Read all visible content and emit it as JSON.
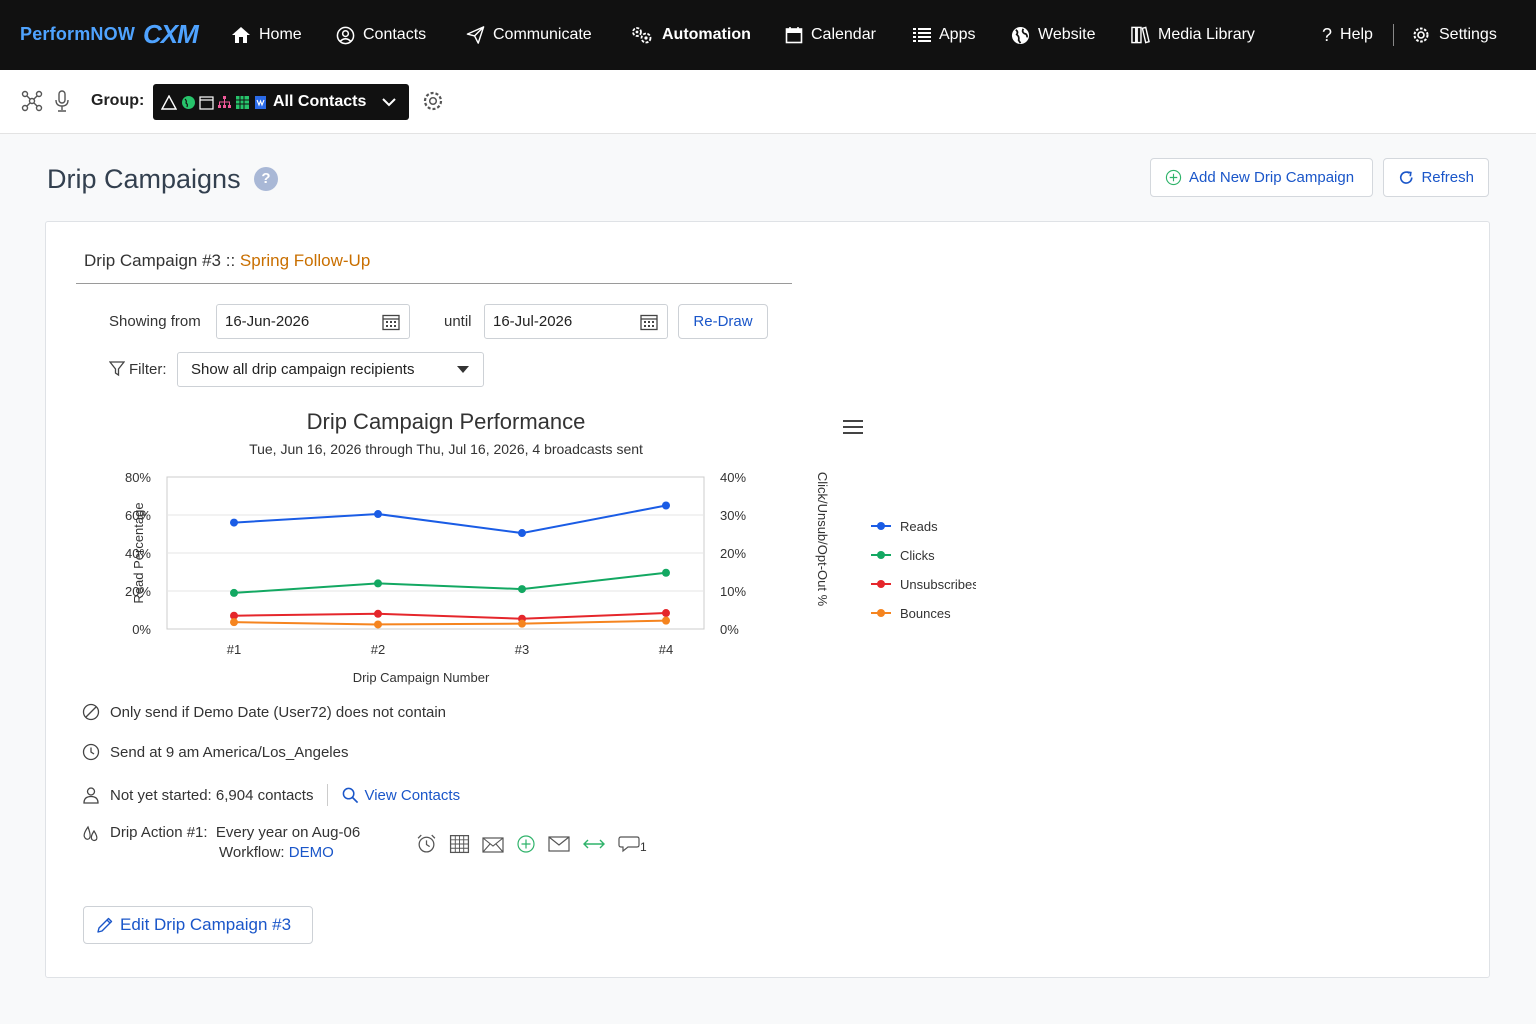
{
  "brand": {
    "name": "PerformNOW",
    "suffix": "CXM",
    "color": "#4fa3ff"
  },
  "nav": {
    "home": "Home",
    "contacts": "Contacts",
    "communicate": "Communicate",
    "automation": "Automation",
    "calendar": "Calendar",
    "apps": "Apps",
    "website": "Website",
    "media": "Media Library",
    "help": "Help",
    "settings": "Settings"
  },
  "group": {
    "label": "Group:",
    "selected": "All Contacts"
  },
  "page": {
    "title": "Drip Campaigns",
    "help": "?",
    "add_button": "Add New Drip Campaign",
    "refresh_button": "Refresh"
  },
  "campaign": {
    "prefix": "Drip Campaign #3 :: ",
    "name": "Spring Follow-Up",
    "showing_from_label": "Showing from",
    "from_date": "16-Jun-2026",
    "until_label": "until",
    "until_date": "16-Jul-2026",
    "redraw": "Re-Draw",
    "filter_label": "Filter:",
    "filter_value": "Show all drip campaign recipients",
    "condition": "Only send if Demo Date (User72) does not contain",
    "send_time": "Send at 9 am America/Los_Angeles",
    "not_started_label": "Not yet started:",
    "not_started_value": "6,904 contacts",
    "view_contacts": "View Contacts",
    "action_label": "Drip Action #1:",
    "action_value": "Every year on Aug-06",
    "workflow_label": "Workflow:",
    "workflow_value": "DEMO",
    "comment_count": "1",
    "edit_button": "Edit Drip Campaign #3"
  },
  "chart_data": {
    "type": "line",
    "title": "Drip Campaign Performance",
    "subtitle": "Tue, Jun 16, 2026 through Thu, Jul 16, 2026, 4 broadcasts sent",
    "xlabel": "Drip Campaign Number",
    "ylabel": "Read Percentage",
    "y2label": "Click/Unsub/Opt-Out %",
    "categories": [
      "#1",
      "#2",
      "#3",
      "#4"
    ],
    "ylim": [
      0,
      80
    ],
    "y2lim": [
      0,
      40
    ],
    "yticks": [
      "0%",
      "20%",
      "40%",
      "60%",
      "80%"
    ],
    "y2ticks": [
      "0%",
      "10%",
      "20%",
      "30%",
      "40%"
    ],
    "legend_position": "right",
    "series": [
      {
        "name": "Reads",
        "axis": "left",
        "color": "#1a5ce5",
        "values": [
          56,
          60.5,
          50.5,
          65
        ]
      },
      {
        "name": "Clicks",
        "axis": "right",
        "color": "#13a862",
        "values": [
          9.5,
          12,
          10.5,
          14.8
        ]
      },
      {
        "name": "Unsubscribes",
        "axis": "right",
        "color": "#e5262b",
        "values": [
          3.5,
          4,
          2.7,
          4.2
        ]
      },
      {
        "name": "Bounces",
        "axis": "right",
        "color": "#f5841f",
        "values": [
          1.8,
          1.2,
          1.4,
          2.2
        ]
      }
    ]
  }
}
